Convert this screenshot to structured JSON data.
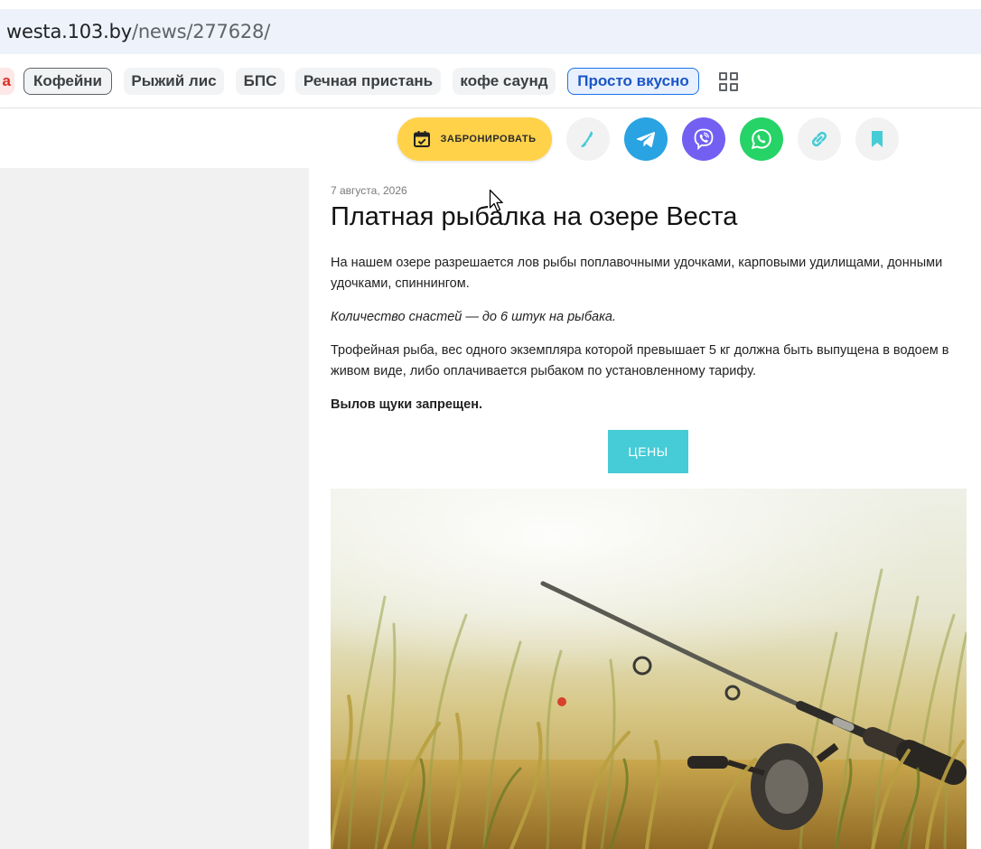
{
  "browser": {
    "url_host": "westa.103.by",
    "url_path": "/news/277628/"
  },
  "chips": {
    "cut_label": "а",
    "items": [
      "Кофейни",
      "Рыжий лис",
      "БПС",
      "Речная пристань",
      "кофе саунд",
      "Просто вкусно"
    ],
    "more_icon": "grid-icon"
  },
  "actions": {
    "book_label": "ЗАБРОНИРОВАТЬ",
    "icons": [
      "calendar-check-icon",
      "phone-icon",
      "telegram-icon",
      "viber-icon",
      "whatsapp-icon",
      "link-icon",
      "bookmark-icon"
    ]
  },
  "article": {
    "date": "7 августа, 2026",
    "title": "Платная рыбалка на озере Веста",
    "p1": "На нашем озере разрешается лов рыбы поплавочными удочками, карповыми удилищами, донными удочками, спиннингом.",
    "p2": "Количество снастей — до 6 штук на рыбака.",
    "p3": "Трофейная рыба, вес одного экземпляра которой превышает 5 кг должна быть выпущена в водоем в живом виде, либо оплачивается рыбаком по установленному тарифу.",
    "p4": "Вылов щуки запрещен.",
    "prices_label": "ЦЕНЫ"
  },
  "colors": {
    "book_button": "#ffd24a",
    "telegram": "#2aa3e3",
    "viber": "#7360f2",
    "whatsapp": "#25d366",
    "accent": "#45ccd6",
    "active_chip": "#1a73e8"
  }
}
